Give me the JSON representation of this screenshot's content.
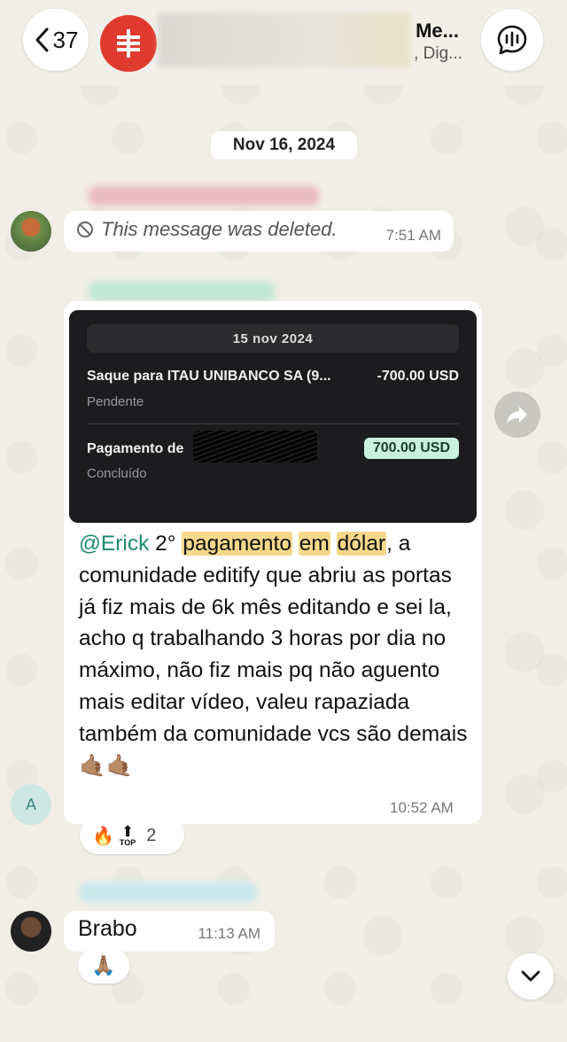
{
  "header": {
    "back_count": "37",
    "group_title": "Me...",
    "group_subtitle": ", Dig...",
    "back_icon": "chevron-left-icon",
    "audio_icon": "audio-wave-icon"
  },
  "date_chip": "Nov 16, 2024",
  "messages": {
    "deleted": {
      "text": "This message was deleted.",
      "time": "7:51 AM"
    },
    "main": {
      "receipt": {
        "date": "15 nov 2024",
        "row1_title": "Saque para ITAU UNIBANCO SA (9...",
        "row1_amount": "-700.00 USD",
        "row1_status": "Pendente",
        "row2_title": "Pagamento de",
        "row2_amount": "700.00 USD",
        "row2_status": "Concluído"
      },
      "mention": "@Erick",
      "text_a": " 2° ",
      "hl1": "pagamento",
      "hl2": "em",
      "hl3": "dólar",
      "text_b": ", a comunidade editify  que abriu as portas já fiz mais de 6k mês editando e sei la, acho q trabalhando 3 horas por dia no máximo, não fiz mais pq não aguento mais editar vídeo, valeu rapaziada também da comunidade vcs são demais 🤙🏽🤙🏽",
      "time": "10:52 AM",
      "reactions": {
        "emoji1": "🔥",
        "top_label": "TOP",
        "count": "2"
      },
      "sender_initial": "A"
    },
    "brabo": {
      "text": "Brabo",
      "time": "11:13 AM",
      "reaction": "🙏🏽"
    }
  },
  "colors": {
    "mention": "#1f8a70",
    "highlight": "#f6d88a",
    "receipt_bg": "#1c1c1e",
    "amount_badge": "#c8f0de"
  }
}
